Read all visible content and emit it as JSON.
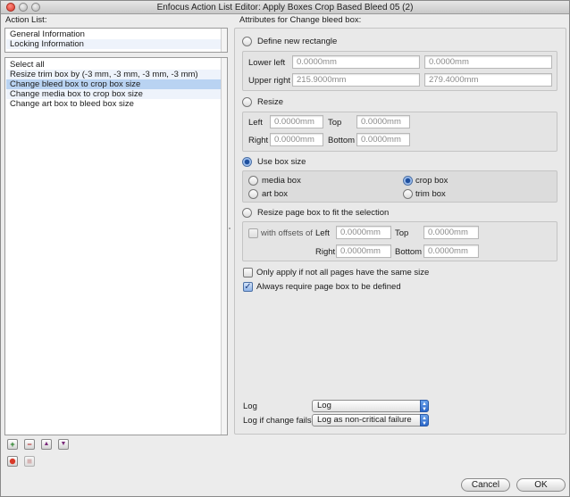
{
  "window": {
    "title": "Enfocus Action List Editor: Apply Boxes Crop Based Bleed 05 (2)"
  },
  "left": {
    "header": "Action List:",
    "info_items": [
      "General Information",
      "Locking Information"
    ],
    "actions": [
      "Select all",
      "Resize trim box by (-3 mm, -3 mm, -3 mm, -3 mm)",
      "Change bleed box to crop box size",
      "Change media box to crop box size",
      "Change art box to bleed box size"
    ],
    "selected_action_index": 2,
    "buttons": [
      "+",
      "−",
      "▲",
      "▼"
    ]
  },
  "right": {
    "header": "Attributes for Change bleed box:",
    "define_new_rectangle": {
      "label": "Define new rectangle",
      "selected": false,
      "lower_left_label": "Lower left",
      "lower_left_x": "0.0000mm",
      "lower_left_y": "0.0000mm",
      "upper_right_label": "Upper right",
      "upper_right_x": "215.9000mm",
      "upper_right_y": "279.4000mm"
    },
    "resize": {
      "label": "Resize",
      "selected": false,
      "left_label": "Left",
      "left": "0.0000mm",
      "top_label": "Top",
      "top": "0.0000mm",
      "right_label": "Right",
      "right": "0.0000mm",
      "bottom_label": "Bottom",
      "bottom": "0.0000mm"
    },
    "use_box_size": {
      "label": "Use box size",
      "selected": true,
      "options": {
        "media_box": "media box",
        "art_box": "art box",
        "crop_box": "crop box",
        "trim_box": "trim box"
      },
      "selected_option": "crop box"
    },
    "resize_page_box": {
      "label": "Resize page box to fit the selection",
      "selected": false,
      "offsets_label": "with offsets of",
      "left_label": "Left",
      "left": "0.0000mm",
      "top_label": "Top",
      "top": "0.0000mm",
      "right_label": "Right",
      "right": "0.0000mm",
      "bottom_label": "Bottom",
      "bottom": "0.0000mm"
    },
    "only_apply": {
      "label": "Only apply if not all pages have the same size",
      "checked": false
    },
    "always_require": {
      "label": "Always require page box to be defined",
      "checked": true
    },
    "log": {
      "label": "Log",
      "value": "Log"
    },
    "log_if_fails": {
      "label": "Log if change fails",
      "value": "Log as non-critical failure"
    }
  },
  "footer": {
    "cancel": "Cancel",
    "ok": "OK"
  },
  "colors": {
    "selection": "#b9d3f2",
    "accent": "#2a66c8"
  }
}
